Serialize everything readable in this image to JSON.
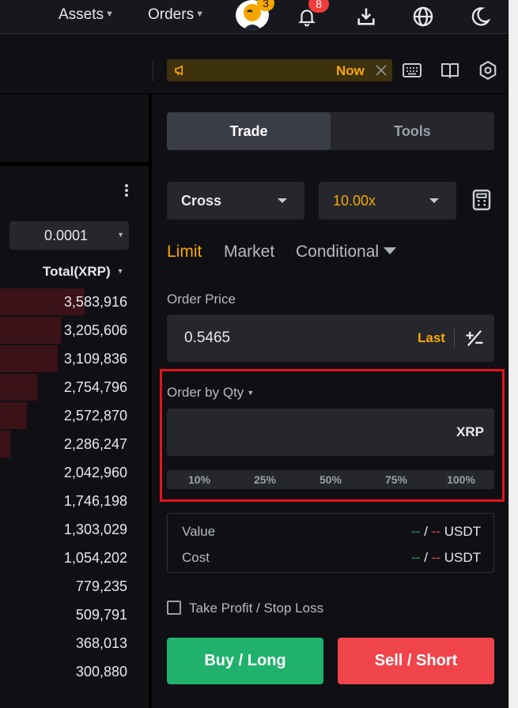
{
  "nav": {
    "assets_label": "Assets",
    "orders_label": "Orders",
    "avatar_badge": "3",
    "notifications_badge": "8"
  },
  "announcement": {
    "now_label": "Now"
  },
  "orderbook": {
    "tick_size": "0.0001",
    "total_header": "Total(XRP)",
    "rows": [
      {
        "total": "3,583,916",
        "depth": 0.57
      },
      {
        "total": "3,205,606",
        "depth": 0.41
      },
      {
        "total": "3,109,836",
        "depth": 0.39
      },
      {
        "total": "2,754,796",
        "depth": 0.25
      },
      {
        "total": "2,572,870",
        "depth": 0.18
      },
      {
        "total": "2,286,247",
        "depth": 0.07
      },
      {
        "total": "2,042,960",
        "depth": 0
      },
      {
        "total": "1,746,198",
        "depth": 0
      },
      {
        "total": "1,303,029",
        "depth": 0
      },
      {
        "total": "1,054,202",
        "depth": 0
      },
      {
        "total": "779,235",
        "depth": 0
      },
      {
        "total": "509,791",
        "depth": 0
      },
      {
        "total": "368,013",
        "depth": 0
      },
      {
        "total": "300,880",
        "depth": 0
      }
    ]
  },
  "panel": {
    "tabs": [
      "Trade",
      "Tools"
    ],
    "margin_mode": "Cross",
    "leverage": "10.00x",
    "order_types": [
      "Limit",
      "Market",
      "Conditional"
    ],
    "order_price_label": "Order Price",
    "order_price_value": "0.5465",
    "last_label": "Last",
    "order_by_label": "Order by Qty",
    "qty_unit": "XRP",
    "percentages": [
      "10%",
      "25%",
      "50%",
      "75%",
      "100%"
    ],
    "value_label": "Value",
    "cost_label": "Cost",
    "placeholder_dash": "--",
    "slash": "/",
    "quote_unit": "USDT",
    "tpsl_label": "Take Profit / Stop Loss",
    "buy_label": "Buy / Long",
    "sell_label": "Sell / Short"
  },
  "colors": {
    "buy": "#20b26c",
    "sell": "#ef454a",
    "accent": "#f7a600",
    "highlight_border": "#e4141b"
  }
}
